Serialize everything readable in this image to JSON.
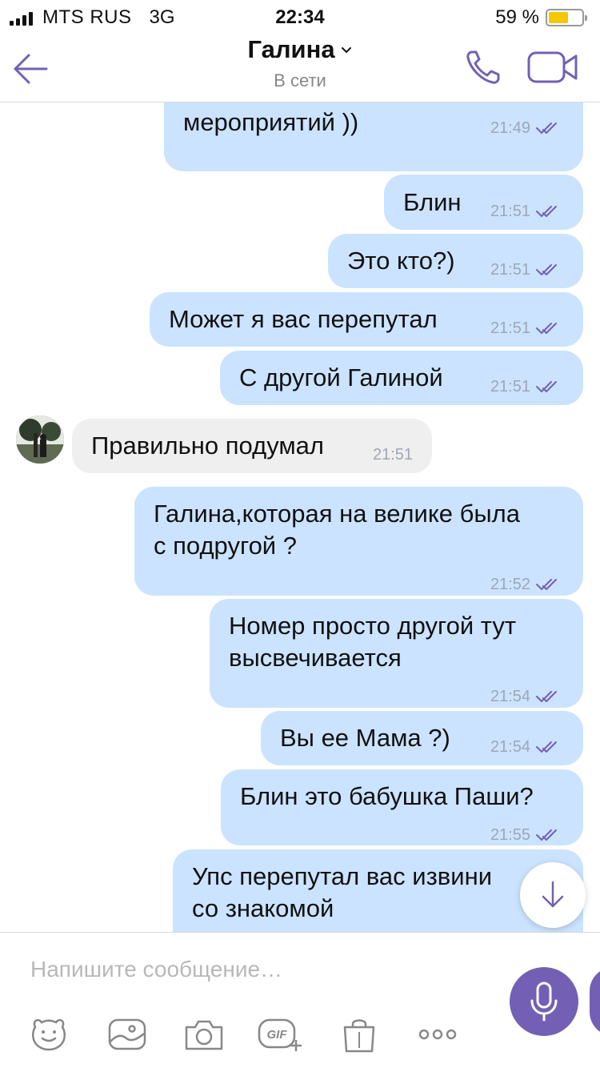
{
  "status_bar": {
    "carrier": "MTS RUS",
    "network": "3G",
    "time": "22:34",
    "battery_text": "59 %",
    "battery_level": 0.59
  },
  "header": {
    "title": "Галина",
    "subtitle": "В сети",
    "icons": {
      "back": "back-arrow-icon",
      "call": "phone-icon",
      "video": "video-camera-icon",
      "chevron": "chevron-down-icon"
    }
  },
  "messages": [
    {
      "dir": "out",
      "text": "мероприятий ))",
      "time": "21:49",
      "read": true
    },
    {
      "dir": "out",
      "text": "Блин",
      "time": "21:51",
      "read": true
    },
    {
      "dir": "out",
      "text": "Это кто?)",
      "time": "21:51",
      "read": true
    },
    {
      "dir": "out",
      "text": "Может я вас перепутал",
      "time": "21:51",
      "read": true
    },
    {
      "dir": "out",
      "text": "С другой Галиной",
      "time": "21:51",
      "read": true
    },
    {
      "dir": "in",
      "text": "Правильно подумал",
      "time": "21:51"
    },
    {
      "dir": "out",
      "lines": [
        "Галина,которая на велике была",
        "с подругой ?"
      ],
      "time": "21:52",
      "read": true
    },
    {
      "dir": "out",
      "lines": [
        "Номер просто другой тут",
        "высвечивается"
      ],
      "time": "21:54",
      "read": true
    },
    {
      "dir": "out",
      "text": "Вы ее Мама ?)",
      "time": "21:54",
      "read": true
    },
    {
      "dir": "out",
      "text": "Блин это бабушка Паши?",
      "time": "21:55",
      "read": true
    },
    {
      "dir": "out",
      "lines": [
        "Упс перепутал вас извини",
        "со знакомой"
      ]
    }
  ],
  "composer": {
    "placeholder": "Напишите сообщение…",
    "toolbar": [
      "sticker-icon",
      "gallery-icon",
      "camera-icon",
      "gif-icon",
      "shopping-bag-icon",
      "more-icon"
    ],
    "mic_icon": "microphone-icon"
  },
  "colors": {
    "accent": "#7360b5",
    "outgoing_bubble": "#cbe3ff",
    "incoming_bubble": "#efefef",
    "meta_text": "#9ea7b4"
  }
}
